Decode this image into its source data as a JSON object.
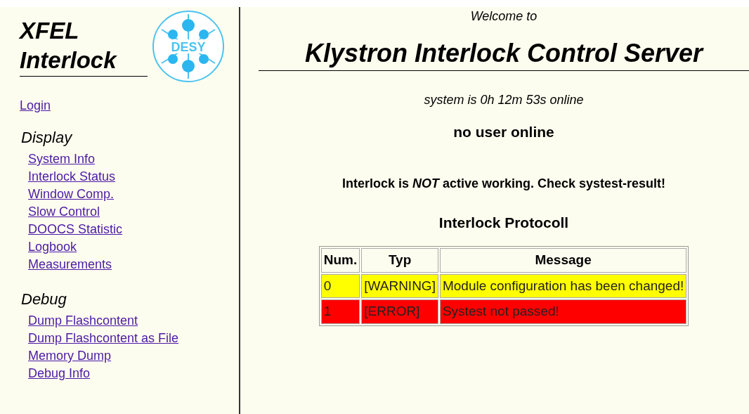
{
  "sidebar": {
    "title_lines": [
      "XFEL",
      "Interlock"
    ],
    "logo_text": "DESY",
    "login": "Login",
    "sections": [
      {
        "heading": "Display",
        "links": [
          "System Info",
          "Interlock Status",
          "Window Comp.",
          "Slow Control",
          "DOOCS Statistic",
          "Logbook",
          "Measurements"
        ]
      },
      {
        "heading": "Debug",
        "links": [
          "Dump Flashcontent",
          "Dump Flashcontent as File",
          "Memory Dump",
          "Debug Info"
        ]
      }
    ]
  },
  "main": {
    "welcome": "Welcome to",
    "title": "Klystron Interlock Control Server",
    "uptime": "system is 0h 12m 53s online",
    "users": "no user online",
    "status": "Interlock is *NOT* active working. Check systest-result!",
    "protocol_title": "Interlock Protocoll",
    "table": {
      "columns": [
        "Num.",
        "Typ",
        "Message"
      ],
      "rows": [
        {
          "cells": [
            "0",
            "[WARNING]",
            "Module configuration has been changed!"
          ],
          "color": "#ffff00"
        },
        {
          "cells": [
            "1",
            "[ERROR]",
            "Systest not passed!"
          ],
          "color": "#ff0000"
        }
      ]
    }
  }
}
